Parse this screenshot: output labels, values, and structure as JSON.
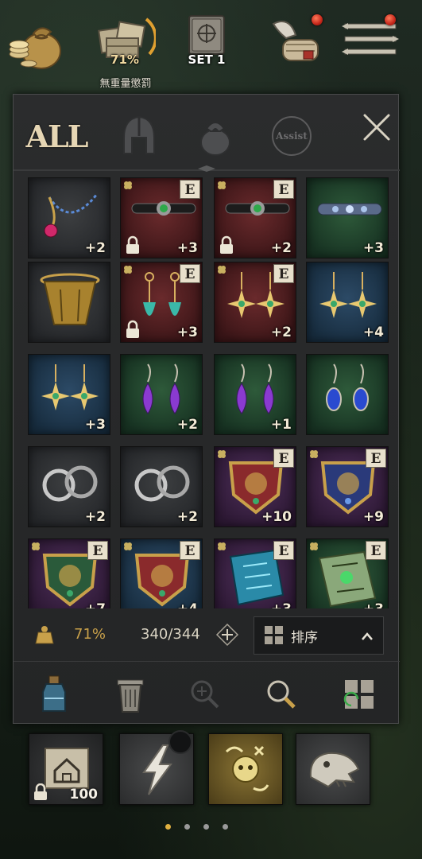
{
  "hud": {
    "weight_percent": "71%",
    "weight_caption": "無重量懲罰",
    "set_label": "SET 1"
  },
  "tabs": {
    "all_label": "ALL",
    "assist_label": "Assist"
  },
  "grid": {
    "rows": [
      [
        {
          "item": "necklace",
          "bg": "gray",
          "plus": "+2",
          "badge": "",
          "locked": false
        },
        {
          "item": "choker-green",
          "bg": "red",
          "plus": "+3",
          "badge": "E",
          "locked": true
        },
        {
          "item": "choker-green",
          "bg": "red",
          "plus": "+2",
          "badge": "E",
          "locked": true
        },
        {
          "item": "choker-blue",
          "bg": "green",
          "plus": "+3",
          "badge": "",
          "locked": false
        }
      ],
      [
        {
          "item": "basket-belt",
          "bg": "gray",
          "plus": "",
          "badge": "",
          "locked": false
        },
        {
          "item": "earrings-feather",
          "bg": "red",
          "plus": "+3",
          "badge": "E",
          "locked": true
        },
        {
          "item": "earrings-star",
          "bg": "red",
          "plus": "+2",
          "badge": "E",
          "locked": false
        },
        {
          "item": "earrings-star",
          "bg": "blue",
          "plus": "+4",
          "badge": "",
          "locked": false
        }
      ],
      [
        {
          "item": "earrings-star",
          "bg": "blue",
          "plus": "+3",
          "badge": "",
          "locked": false
        },
        {
          "item": "earrings-purple",
          "bg": "green",
          "plus": "+2",
          "badge": "",
          "locked": false
        },
        {
          "item": "earrings-purple",
          "bg": "green",
          "plus": "+1",
          "badge": "",
          "locked": false
        },
        {
          "item": "earrings-blue",
          "bg": "green",
          "plus": "",
          "badge": "",
          "locked": false
        }
      ],
      [
        {
          "item": "hoop-earrings",
          "bg": "gray",
          "plus": "+2",
          "badge": "",
          "locked": false
        },
        {
          "item": "hoop-earrings",
          "bg": "gray",
          "plus": "+2",
          "badge": "",
          "locked": false
        },
        {
          "item": "crest-red",
          "bg": "purple",
          "plus": "+10",
          "badge": "E",
          "locked": false
        },
        {
          "item": "crest-blue",
          "bg": "purple",
          "plus": "+9",
          "badge": "E",
          "locked": false
        }
      ],
      [
        {
          "item": "crest-green",
          "bg": "purple",
          "plus": "+7",
          "badge": "E",
          "locked": false
        },
        {
          "item": "crest-red",
          "bg": "blue",
          "plus": "+4",
          "badge": "E",
          "locked": false
        },
        {
          "item": "tome-cyan",
          "bg": "purple",
          "plus": "+3",
          "badge": "E",
          "locked": false
        },
        {
          "item": "tome-green",
          "bg": "green",
          "plus": "+3",
          "badge": "E",
          "locked": false
        }
      ]
    ]
  },
  "stats": {
    "weight_percent": "71%",
    "capacity": "340/344",
    "sort_label": "排序"
  },
  "quickslots": {
    "home_count": "100"
  },
  "colors": {
    "accent_gold": "#c8a04a",
    "text_light": "#e9e4d8",
    "panel_bg": "#2b2c2d"
  }
}
